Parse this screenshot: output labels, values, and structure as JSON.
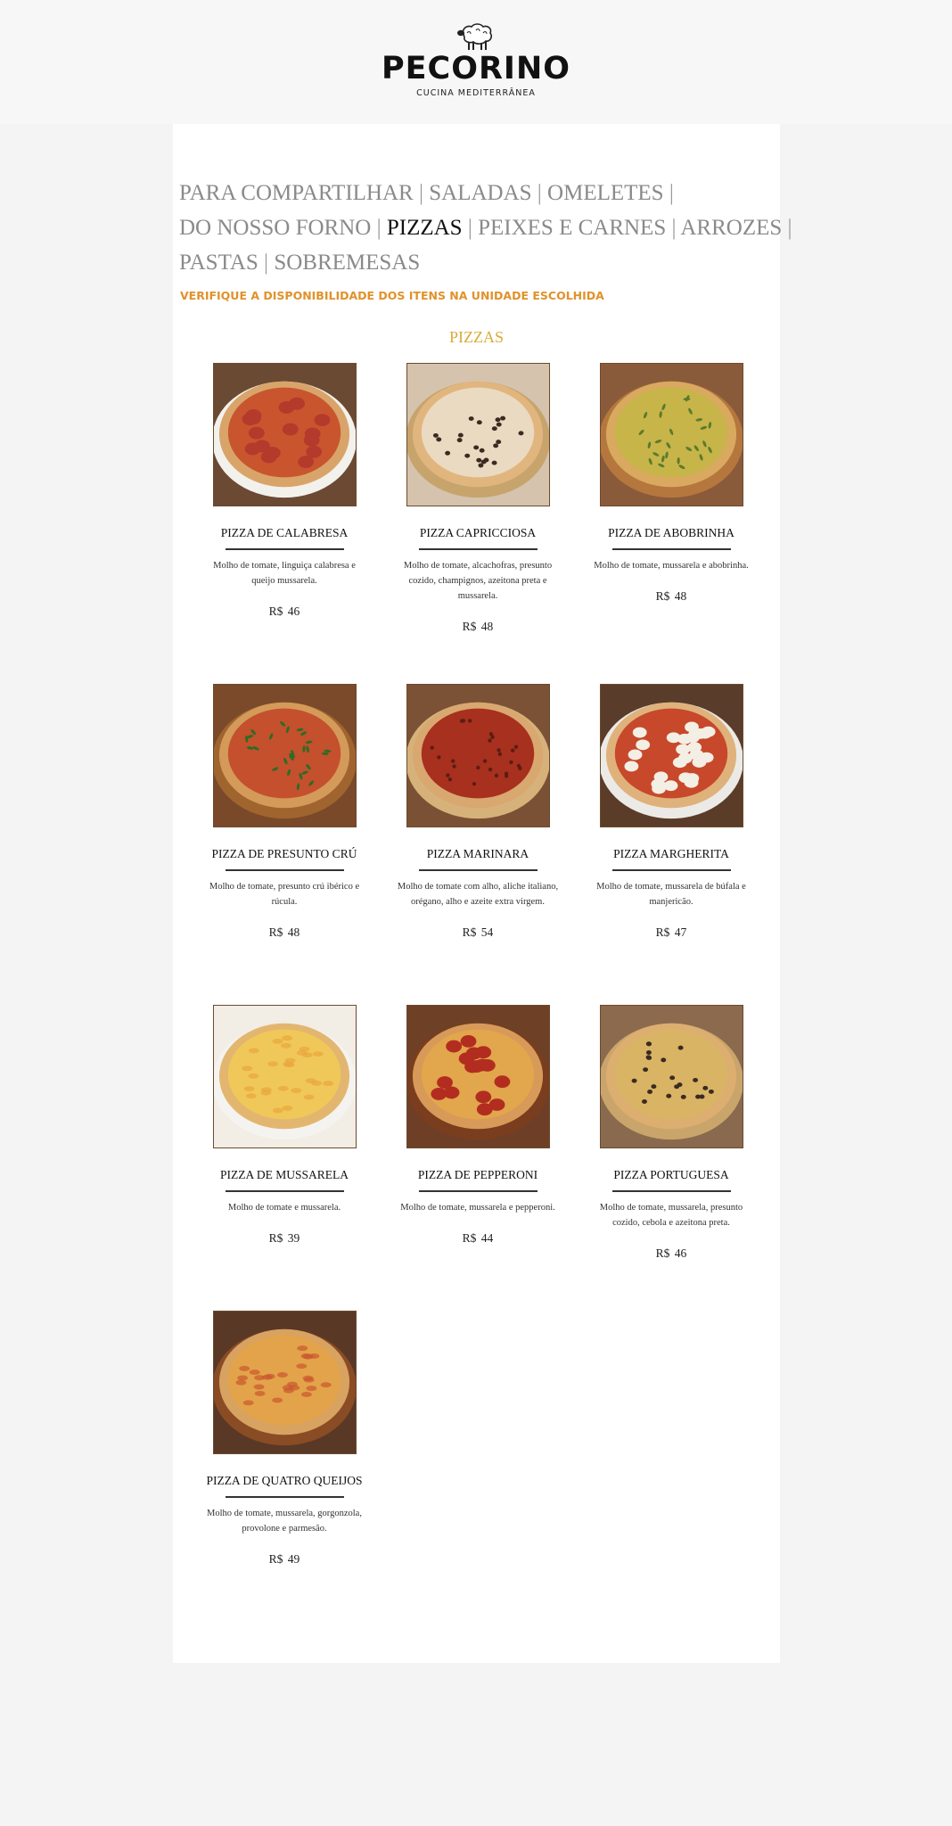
{
  "brand": {
    "name": "PECORINO",
    "tagline": "CUCINA MEDITERRÂNEA"
  },
  "nav": {
    "lines": [
      [
        {
          "label": "PARA COMPARTILHAR"
        },
        {
          "label": "SALADAS"
        },
        {
          "label": "OMELETES",
          "trailing": true
        }
      ],
      [
        {
          "label": "DO NOSSO FORNO"
        },
        {
          "label": "PIZZAS",
          "active": true
        },
        {
          "label": "PEIXES E CARNES"
        },
        {
          "label": "ARROZES",
          "trailing": true
        }
      ],
      [
        {
          "label": "PASTAS"
        },
        {
          "label": "SOBREMESAS"
        }
      ]
    ],
    "separator": "|"
  },
  "notice": "VERIFIQUE A DISPONIBILIDADE DOS ITENS NA UNIDADE ESCOLHIDA",
  "section_title": "PIZZAS",
  "products": [
    {
      "name": "PIZZA DE CALABRESA",
      "description": "Molho de tomate, linguiça calabresa e queijo mussarela.",
      "price": "R$  46",
      "image": {
        "crust": "#d9a46a",
        "sauce": "#c8552e",
        "topping": "#b43a2c",
        "style": "slices",
        "bg": "#6b4a33",
        "plate": "#f3f1ec"
      }
    },
    {
      "name": "PIZZA CAPRICCIOSA",
      "description": "Molho de tomate, alcachofras, presunto cozido, champignos, azeitona preta e mussarela.",
      "price": "R$  48",
      "image": {
        "crust": "#e1b57e",
        "sauce": "#eadac1",
        "topping": "#3a2b22",
        "style": "olives",
        "bg": "#d5c3ae",
        "plate": "#c7a46c"
      }
    },
    {
      "name": "PIZZA DE ABOBRINHA",
      "description": "Molho de tomate, mussarela e abobrinha.",
      "price": "R$  48",
      "image": {
        "crust": "#d8a95f",
        "sauce": "#c7b54a",
        "topping": "#5d7a2b",
        "style": "herbs",
        "bg": "#8a5b3a",
        "plate": "#b5773e"
      }
    },
    {
      "name": "PIZZA DE PRESUNTO CRÚ",
      "description": "Molho de tomate, presunto crú ibérico e rúcula.",
      "price": "R$  48",
      "image": {
        "crust": "#d49a59",
        "sauce": "#c4502e",
        "topping": "#2f6b23",
        "style": "rucula",
        "bg": "#7a4a2a",
        "plate": "#a0642f"
      }
    },
    {
      "name": "PIZZA MARINARA",
      "description": "Molho de tomate com alho, aliche italiano, orégano, alho e azeite extra virgem.",
      "price": "R$  54",
      "image": {
        "crust": "#d9a770",
        "sauce": "#a8301e",
        "topping": "#5a1d12",
        "style": "dots",
        "bg": "#7b5236",
        "plate": "#d6b27a"
      }
    },
    {
      "name": "PIZZA MARGHERITA",
      "description": "Molho de tomate, mussarela de búfala e manjericão.",
      "price": "R$  47",
      "image": {
        "crust": "#dfb27c",
        "sauce": "#c8482b",
        "topping": "#f4efe4",
        "style": "blobs",
        "bg": "#5a3c2a",
        "plate": "#eceae6"
      }
    },
    {
      "name": "PIZZA DE MUSSARELA",
      "description": "Molho de tomate e mussarela.",
      "price": "R$  39",
      "image": {
        "crust": "#e3b670",
        "sauce": "#f0c85a",
        "topping": "#e8a63c",
        "style": "cheese",
        "bg": "#f2ede5",
        "plate": "#f5f3ef"
      }
    },
    {
      "name": "PIZZA DE PEPPERONI",
      "description": "Molho de tomate, mussarela e pepperoni.",
      "price": "R$  44",
      "image": {
        "crust": "#d79a58",
        "sauce": "#e2a64d",
        "topping": "#b22d1f",
        "style": "slices",
        "bg": "#6e4026",
        "plate": "#7a3e1e"
      }
    },
    {
      "name": "PIZZA PORTUGUESA",
      "description": "Molho de tomate, mussarela, presunto cozido, cebola e azeitona preta.",
      "price": "R$  46",
      "image": {
        "crust": "#dcae70",
        "sauce": "#d9b464",
        "topping": "#3a2b22",
        "style": "olives",
        "bg": "#8b6a4e",
        "plate": "#caa56b"
      }
    },
    {
      "name": "PIZZA DE QUATRO QUEIJOS",
      "description": "Molho de tomate, mussarela, gorgonzola, provolone e parmesão.",
      "price": "R$  49",
      "image": {
        "crust": "#d8a260",
        "sauce": "#e3a34a",
        "topping": "#c9572e",
        "style": "cheese",
        "bg": "#5a3826",
        "plate": "#8a4c25"
      }
    }
  ]
}
